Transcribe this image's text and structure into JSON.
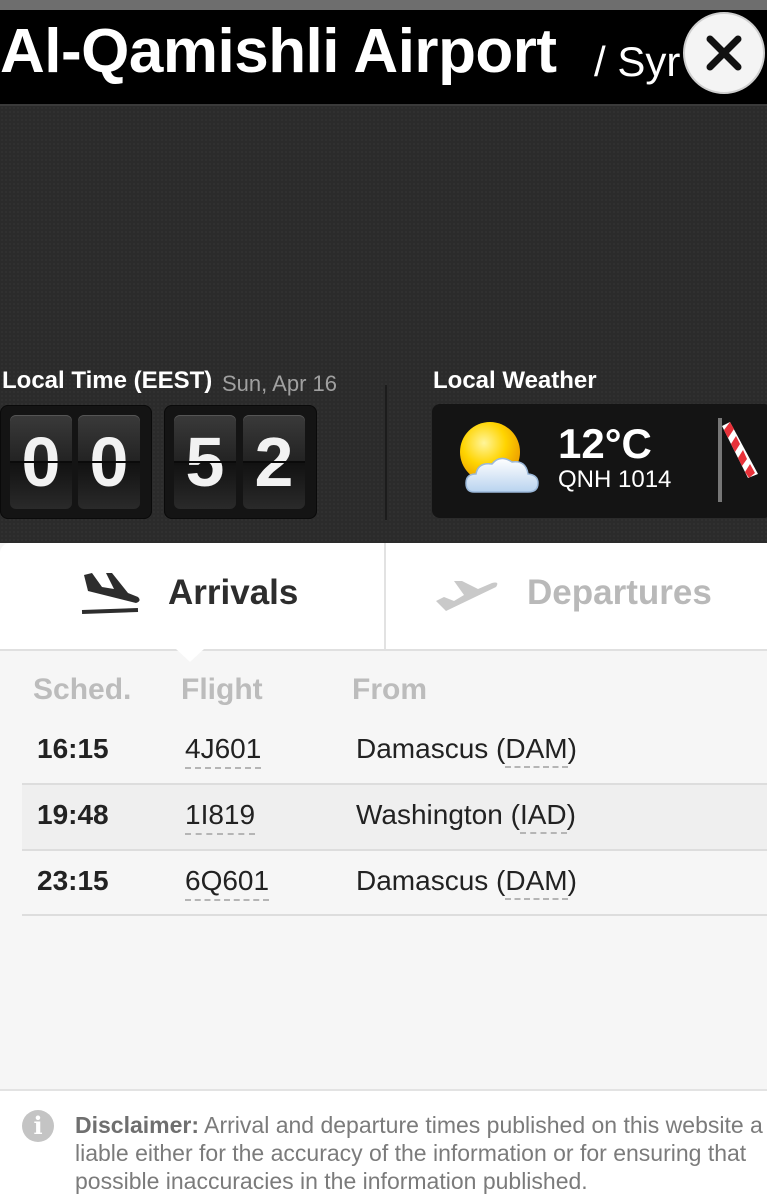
{
  "header": {
    "title": "Al-Qamishli Airport",
    "country_fragment": "/ Syr",
    "close_label": "close"
  },
  "local_time": {
    "label": "Local Time (EEST)",
    "date": "Sun, Apr 16",
    "hour_digits": [
      "0",
      "0"
    ],
    "minute_digits": [
      "5",
      "2"
    ]
  },
  "weather": {
    "label": "Local Weather",
    "temperature": "12°C",
    "qnh": "QNH 1014",
    "icon": "partly-cloudy-icon",
    "windsock_icon": "windsock-icon"
  },
  "tabs": {
    "arrivals": "Arrivals",
    "departures": "Departures",
    "active": "arrivals"
  },
  "table": {
    "columns": [
      "Sched.",
      "Flight",
      "From"
    ],
    "rows": [
      {
        "sched": "16:15",
        "flight": "4J601",
        "city": "Damascus (",
        "code": "DAM",
        "close": ")"
      },
      {
        "sched": "19:48",
        "flight": "1I819",
        "city": "Washington (",
        "code": "IAD",
        "close": ")"
      },
      {
        "sched": "23:15",
        "flight": "6Q601",
        "city": "Damascus (",
        "code": "DAM",
        "close": ")"
      }
    ]
  },
  "disclaimer": {
    "bold": "Disclaimer:",
    "line1": "Arrival and departure times published on this website a",
    "line2": "liable either for the accuracy of the information or for ensuring that",
    "line3": "possible inaccuracies in the information published."
  },
  "colors": {
    "header_bg": "#000000",
    "panel_bg": "#2b2b2b",
    "active_tab_text": "#2d2d2d",
    "inactive_tab_text": "#b9b9b9"
  }
}
